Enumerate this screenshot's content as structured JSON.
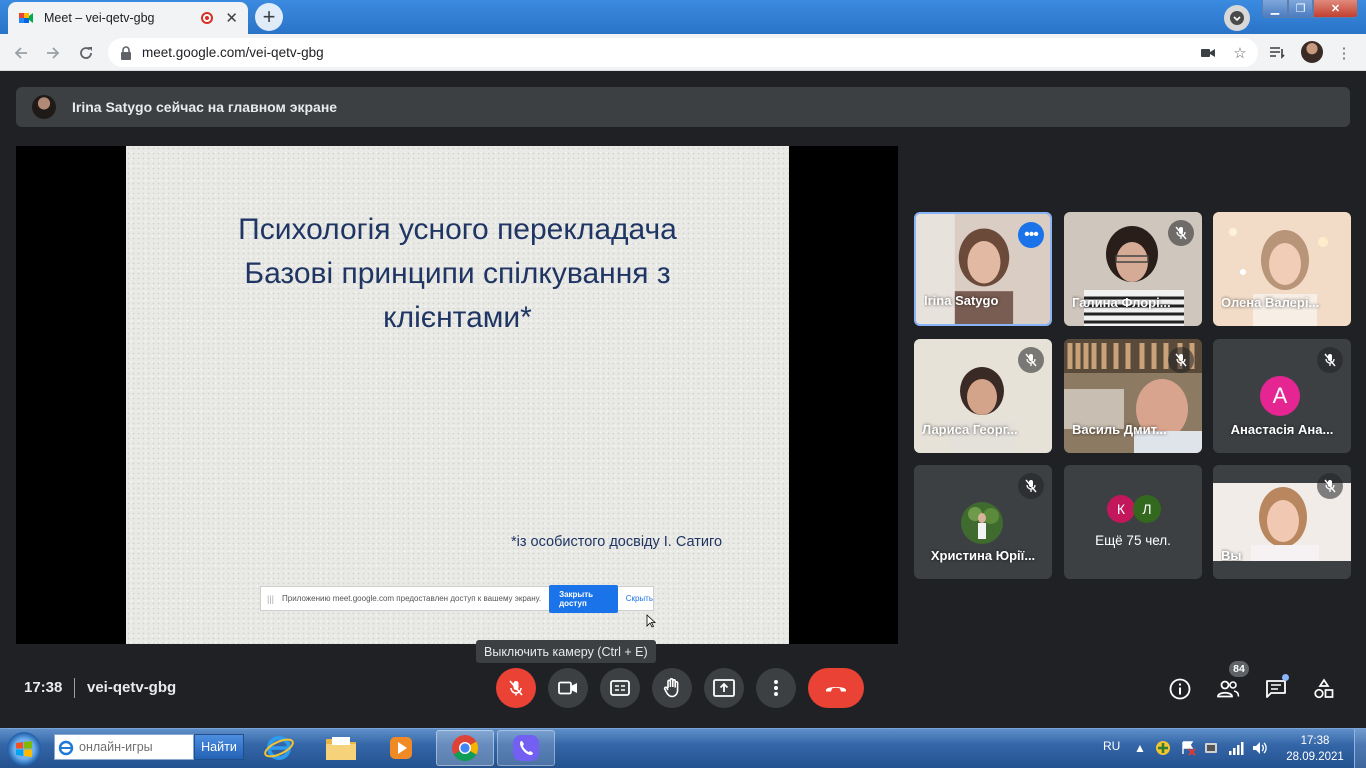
{
  "browser": {
    "tab_title": "Meet – vei-qetv-gbg",
    "url": "meet.google.com/vei-qetv-gbg"
  },
  "banner": {
    "text": "Irina Satygo сейчас на главном экране"
  },
  "slide": {
    "title_line1": "Психологія усного перекладача",
    "title_line2": "Базові принципи спілкування з",
    "title_line3": "клієнтами*",
    "footnote": "*із особистого досвіду І. Сатиго"
  },
  "share_notice": {
    "grip": "|||",
    "text": "Приложению meet.google.com предоставлен доступ к вашему экрану.",
    "stop_label": "Закрыть доступ",
    "hide_label": "Скрыть"
  },
  "participants": [
    {
      "name": "Irina Satygo",
      "kind": "video"
    },
    {
      "name": "Галина Флорі...",
      "kind": "video"
    },
    {
      "name": "Олена Валері...",
      "kind": "video"
    },
    {
      "name": "Лариса Георг...",
      "kind": "video"
    },
    {
      "name": "Василь Дмит...",
      "kind": "video"
    },
    {
      "name": "Анастасія Ана...",
      "kind": "avatar",
      "letter": "A",
      "color": "#e52592"
    },
    {
      "name": "Христина Юрії...",
      "kind": "photo"
    },
    {
      "name": "Ещё 75 чел.",
      "kind": "more",
      "letters": [
        "К",
        "Л"
      ],
      "colors": [
        "#c2185b",
        "#33691e"
      ]
    },
    {
      "name": "Вы",
      "kind": "video"
    }
  ],
  "controls": {
    "tooltip": "Выключить камеру (Ctrl + E)",
    "time": "17:38",
    "meeting_code": "vei-qetv-gbg",
    "people_count": "84"
  },
  "taskbar": {
    "search_placeholder": "онлайн-игры",
    "search_button": "Найти",
    "lang": "RU",
    "clock_time": "17:38",
    "clock_date": "28.09.2021"
  },
  "colors": {
    "meet_bg": "#202124",
    "tile_bg": "#3c4043",
    "danger": "#ea4335",
    "accent": "#1a73e8",
    "slide_text": "#1f3564"
  }
}
